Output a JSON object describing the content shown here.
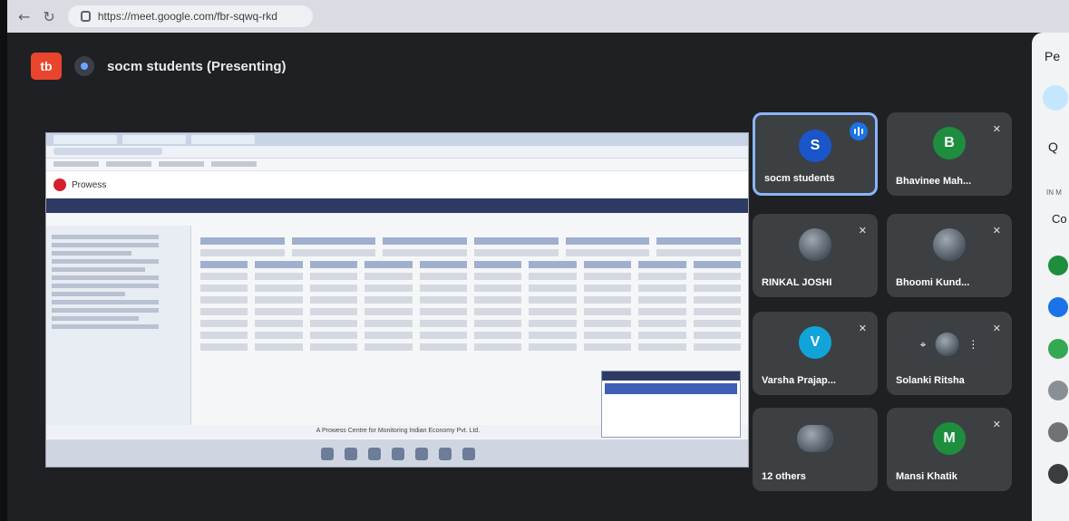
{
  "browser": {
    "url": "https://meet.google.com/fbr-sqwq-rkd"
  },
  "meet": {
    "logo_text": "tb",
    "title": "socm students (Presenting)",
    "accent": "#e8452c"
  },
  "presentation": {
    "brand": "Prowess",
    "footer": "A Prowess Centre for Monitoring Indian Economy Pvt. Ltd."
  },
  "participants": [
    {
      "name": "socm students",
      "initial": "S",
      "color": "#1a56c9",
      "speaking": true
    },
    {
      "name": "Bhavinee Mah...",
      "initial": "B",
      "color": "#1e8e3e",
      "muted": true
    },
    {
      "name": "RINKAL JOSHI",
      "initial": "",
      "photo": true,
      "muted": true
    },
    {
      "name": "Bhoomi Kund...",
      "initial": "",
      "photo": true,
      "muted": true
    },
    {
      "name": "Varsha Prajap...",
      "initial": "V",
      "color": "#12a4d9",
      "muted": true
    },
    {
      "name": "Solanki Ritsha",
      "initial": "",
      "photo": true,
      "muted": true
    },
    {
      "name": "12 others",
      "initial": "",
      "photo": true
    },
    {
      "name": "Mansi Khatik",
      "initial": "M",
      "color": "#1e8e3e",
      "muted": true
    }
  ],
  "side_panel": {
    "title": "Pe",
    "search": "Q",
    "section": "IN M",
    "label": "Co"
  },
  "icons": {
    "back": "back-arrow-icon",
    "reload": "reload-icon",
    "lock": "lock-icon",
    "mic_off": "mic-off-icon",
    "pin": "pin-icon",
    "more": "more-vert-icon"
  }
}
